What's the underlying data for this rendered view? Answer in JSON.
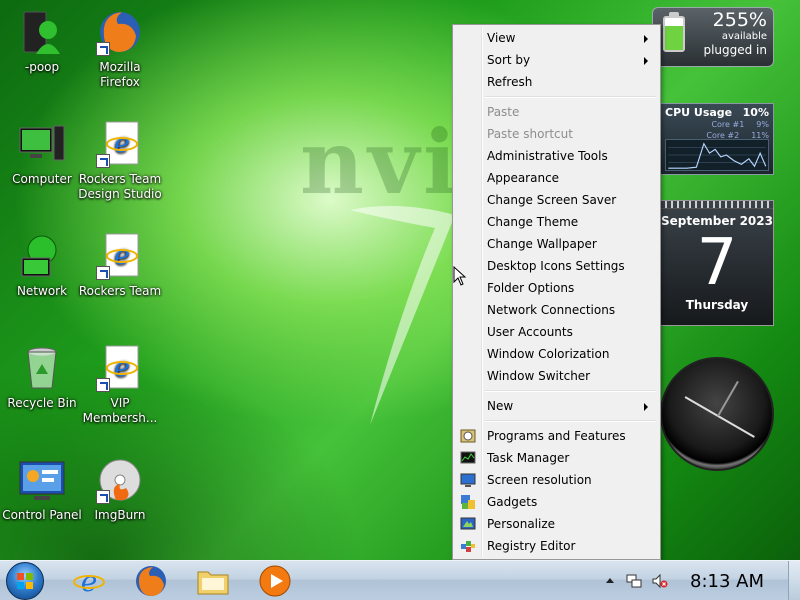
{
  "desktop": {
    "icons": [
      {
        "label": "-poop",
        "icon": "user-tower-icon"
      },
      {
        "label": "Mozilla Firefox",
        "icon": "firefox-icon"
      },
      {
        "label": "Computer",
        "icon": "computer-icon"
      },
      {
        "label": "Rockers Team Design Studio",
        "icon": "ie-document-icon"
      },
      {
        "label": "Network",
        "icon": "network-icon"
      },
      {
        "label": "Rockers Team",
        "icon": "ie-document-icon"
      },
      {
        "label": "Recycle Bin",
        "icon": "recycle-bin-icon"
      },
      {
        "label": "VIP Membersh...",
        "icon": "ie-document-icon"
      },
      {
        "label": "Control Panel",
        "icon": "control-panel-icon"
      },
      {
        "label": "ImgBurn",
        "icon": "imgburn-icon"
      }
    ]
  },
  "wallpaper": {
    "brand_text": "nvidi",
    "accent": "#2fae25"
  },
  "gadgets": {
    "battery": {
      "percent": "255%",
      "status1": "available",
      "status2": "plugged in"
    },
    "cpu": {
      "title": "CPU Usage",
      "total": "10%",
      "core1_label": "Core #1",
      "core1_value": "9%",
      "core2_label": "Core #2",
      "core2_value": "11%"
    },
    "calendar": {
      "month": "September 2023",
      "day": "7",
      "weekday": "Thursday"
    },
    "clock": {
      "icon": "analog-clock-icon"
    }
  },
  "context_menu": {
    "items": [
      {
        "label": "View",
        "submenu": true,
        "disabled": false
      },
      {
        "label": "Sort by",
        "submenu": true,
        "disabled": false
      },
      {
        "label": "Refresh",
        "submenu": false,
        "disabled": false
      },
      {
        "separator": true
      },
      {
        "label": "Paste",
        "submenu": false,
        "disabled": true
      },
      {
        "label": "Paste shortcut",
        "submenu": false,
        "disabled": true
      },
      {
        "label": "Administrative Tools",
        "submenu": false,
        "disabled": false
      },
      {
        "label": "Appearance",
        "submenu": false,
        "disabled": false
      },
      {
        "label": "Change Screen Saver",
        "submenu": false,
        "disabled": false
      },
      {
        "label": "Change Theme",
        "submenu": false,
        "disabled": false
      },
      {
        "label": "Change Wallpaper",
        "submenu": false,
        "disabled": false
      },
      {
        "label": "Desktop Icons Settings",
        "submenu": false,
        "disabled": false
      },
      {
        "label": "Folder Options",
        "submenu": false,
        "disabled": false
      },
      {
        "label": "Network Connections",
        "submenu": false,
        "disabled": false
      },
      {
        "label": "User Accounts",
        "submenu": false,
        "disabled": false
      },
      {
        "label": "Window Colorization",
        "submenu": false,
        "disabled": false
      },
      {
        "label": "Window Switcher",
        "submenu": false,
        "disabled": false
      },
      {
        "separator": true
      },
      {
        "label": "New",
        "submenu": true,
        "disabled": false
      },
      {
        "separator": true
      },
      {
        "label": "Programs and Features",
        "submenu": false,
        "disabled": false,
        "icon": "programs-features-icon"
      },
      {
        "label": "Task Manager",
        "submenu": false,
        "disabled": false,
        "icon": "task-manager-icon"
      },
      {
        "label": "Screen resolution",
        "submenu": false,
        "disabled": false,
        "icon": "monitor-icon"
      },
      {
        "label": "Gadgets",
        "submenu": false,
        "disabled": false,
        "icon": "gadgets-icon"
      },
      {
        "label": "Personalize",
        "submenu": false,
        "disabled": false,
        "icon": "personalize-icon"
      },
      {
        "label": "Registry Editor",
        "submenu": false,
        "disabled": false,
        "icon": "registry-editor-icon"
      }
    ]
  },
  "taskbar": {
    "start_icon": "windows-start-orb-icon",
    "pinned": [
      {
        "name": "internet-explorer-icon"
      },
      {
        "name": "firefox-icon"
      },
      {
        "name": "file-explorer-icon"
      },
      {
        "name": "media-player-icon"
      }
    ],
    "tray": {
      "icons": [
        "show-hidden-icons-arrow",
        "network-tray-icon",
        "volume-muted-icon"
      ],
      "time": "8:13 AM"
    }
  }
}
